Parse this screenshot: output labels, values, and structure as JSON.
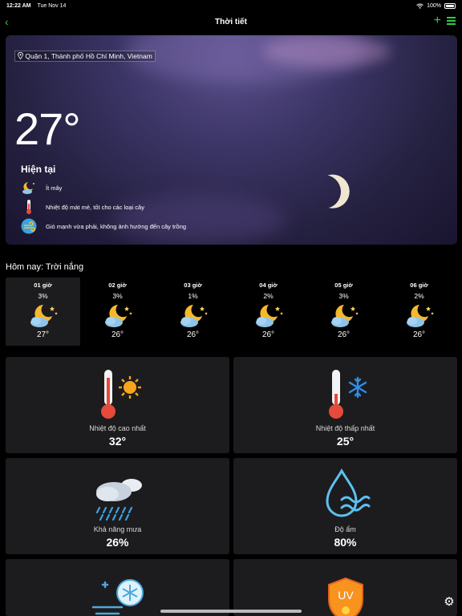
{
  "status": {
    "time": "12:22 AM",
    "date": "Tue Nov 14",
    "battery": "100%"
  },
  "nav": {
    "title": "Thời tiết"
  },
  "hero": {
    "location": "Quận 1, Thành phố Hồ Chí Minh, Vietnam",
    "temperature": "27°",
    "current_label": "Hiện tại",
    "conditions": [
      {
        "icon": "moon-cloud-icon",
        "text": "Ít mây"
      },
      {
        "icon": "thermometer-icon",
        "text": "Nhiệt độ mát mẻ, tốt cho các loại cây"
      },
      {
        "icon": "wind-icon",
        "text": "Gió mạnh vừa phải, không ảnh hưởng đến cây trồng"
      }
    ]
  },
  "today": {
    "label": "Hôm nay: Trời nắng",
    "hours": [
      {
        "hour": "01 giờ",
        "precip": "3%",
        "temp": "27°"
      },
      {
        "hour": "02 giờ",
        "precip": "3%",
        "temp": "26°"
      },
      {
        "hour": "03 giờ",
        "precip": "1%",
        "temp": "26°"
      },
      {
        "hour": "04 giờ",
        "precip": "2%",
        "temp": "26°"
      },
      {
        "hour": "05 giờ",
        "precip": "3%",
        "temp": "26°"
      },
      {
        "hour": "06 giờ",
        "precip": "2%",
        "temp": "26°"
      }
    ]
  },
  "cards": {
    "max_temp": {
      "label": "Nhiệt độ cao nhất",
      "value": "32°"
    },
    "min_temp": {
      "label": "Nhiệt độ thấp nhất",
      "value": "25°"
    },
    "rain": {
      "label": "Khả năng mưa",
      "value": "26%"
    },
    "humidity": {
      "label": "Độ ẩm",
      "value": "80%"
    },
    "uv": {
      "badge": "UV"
    }
  },
  "colors": {
    "accent": "#2ecc40",
    "card_bg": "#1c1c1e",
    "background": "#000000"
  }
}
